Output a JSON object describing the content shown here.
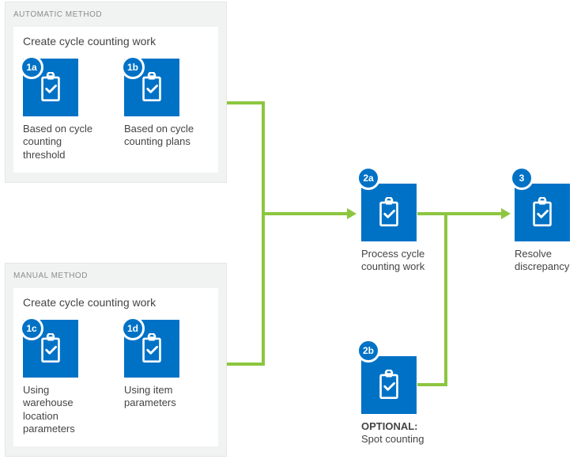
{
  "panels": {
    "automatic": {
      "label": "AUTOMATIC METHOD",
      "card_title": "Create cycle counting work",
      "items": [
        {
          "badge": "1a",
          "label": "Based on cycle counting threshold"
        },
        {
          "badge": "1b",
          "label": "Based on cycle counting plans"
        }
      ]
    },
    "manual": {
      "label": "MANUAL METHOD",
      "card_title": "Create cycle counting work",
      "items": [
        {
          "badge": "1c",
          "label": "Using warehouse location parameters"
        },
        {
          "badge": "1d",
          "label": "Using item parameters"
        }
      ]
    }
  },
  "steps": {
    "process": {
      "badge": "2a",
      "label": "Process cycle counting work"
    },
    "spot": {
      "badge": "2b",
      "label_prefix": "OPTIONAL:",
      "label": "Spot counting"
    },
    "resolve": {
      "badge": "3",
      "label": "Resolve discrepancy"
    }
  },
  "icon": "clipboard-check",
  "colors": {
    "accent": "#0072c6",
    "connector": "#8cc63f",
    "panel_bg": "#f1f2f2"
  }
}
